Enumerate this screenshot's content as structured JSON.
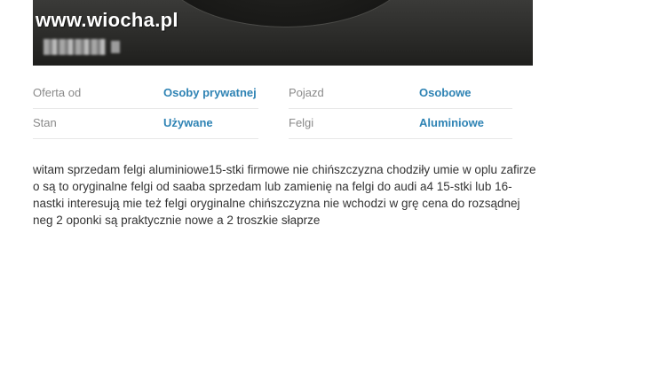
{
  "watermark": "www.wiocha.pl",
  "params": [
    {
      "label": "Oferta od",
      "value": "Osoby prywatnej"
    },
    {
      "label": "Pojazd",
      "value": "Osobowe"
    },
    {
      "label": "Stan",
      "value": "Używane"
    },
    {
      "label": "Felgi",
      "value": "Aluminiowe"
    }
  ],
  "description": "witam sprzedam felgi aluminiowe15-stki firmowe nie chińszczyzna chodziły umie w oplu zafirze o są to oryginalne felgi od saaba sprzedam lub zamienię na felgi do audi a4 15-stki lub 16-nastki interesują mie też felgi oryginalne chińszczyzna nie wchodzi w grę cena do rozsądnej neg 2 oponki są praktycznie nowe a 2 troszkie słaprze",
  "colors": {
    "value_link": "#2e83b4",
    "label": "#8a8a8a"
  }
}
